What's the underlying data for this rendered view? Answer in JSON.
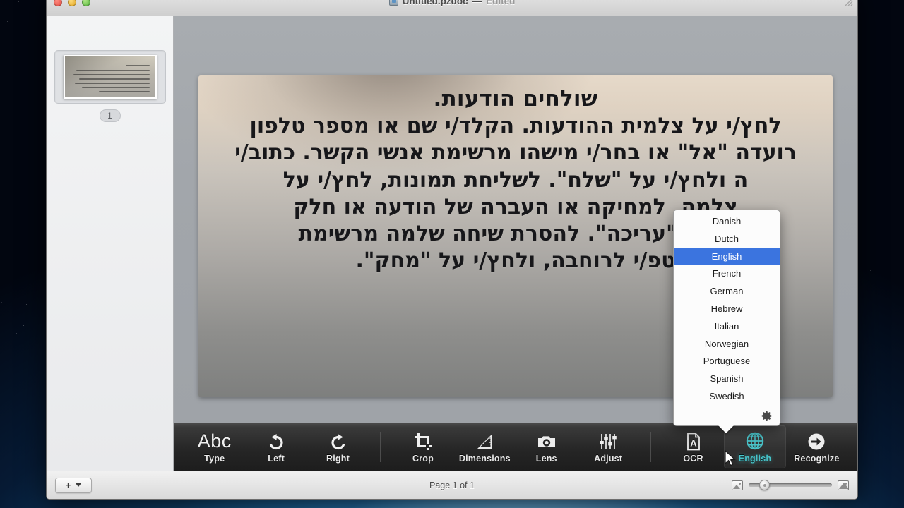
{
  "window": {
    "title": "Untitled.pzdoc",
    "separator": "—",
    "edited_label": "Edited",
    "doc_icon": "document-icon",
    "traffic": {
      "close": "close",
      "minimize": "minimize",
      "zoom": "zoom"
    }
  },
  "sidebar": {
    "page_badge": "1",
    "thumbnail_alt": "page-thumbnail"
  },
  "document": {
    "lines": [
      "שולחים הודעות.",
      "לחץ/י על צלמית ההודעות. הקלד/י שם או מספר טלפון",
      "רועדה \"אל\" או בחר/י מישהו מרשימת אנשי הקשר. כתוב/י",
      "ה ולחץ/י על \"שלח\". לשליחת תמונות, לחץ/י על",
      "צלמה. למחיקה או העברה של הודעה או חלק",
      "/י על \"עריכה\". להסרת שיחה שלמה מרשימת",
      "טפ/י לרוחבה, ולחץ/י על \"מחק\"."
    ]
  },
  "toolbar": {
    "items": [
      {
        "id": "type",
        "label": "Type",
        "icon": "abc-text-icon",
        "active": false
      },
      {
        "id": "left",
        "label": "Left",
        "icon": "rotate-left-icon",
        "active": false
      },
      {
        "id": "right",
        "label": "Right",
        "icon": "rotate-right-icon",
        "active": false
      },
      {
        "id": "crop",
        "label": "Crop",
        "icon": "crop-icon",
        "active": false
      },
      {
        "id": "dimensions",
        "label": "Dimensions",
        "icon": "ruler-triangle-icon",
        "active": false
      },
      {
        "id": "lens",
        "label": "Lens",
        "icon": "camera-icon",
        "active": false
      },
      {
        "id": "adjust",
        "label": "Adjust",
        "icon": "sliders-icon",
        "active": false
      },
      {
        "id": "ocr",
        "label": "OCR",
        "icon": "ocr-page-a-icon",
        "active": false
      },
      {
        "id": "language",
        "label": "English",
        "icon": "globe-icon",
        "active": true
      },
      {
        "id": "recognize",
        "label": "Recognize",
        "icon": "arrow-circle-right-icon",
        "active": false
      }
    ],
    "accent_color": "#49c3c9"
  },
  "language_menu": {
    "options": [
      "Danish",
      "Dutch",
      "English",
      "French",
      "German",
      "Hebrew",
      "Italian",
      "Norwegian",
      "Portuguese",
      "Spanish",
      "Swedish"
    ],
    "selected": "English",
    "selected_color": "#3b74df",
    "settings_icon": "gear-icon"
  },
  "statusbar": {
    "add_label": "+",
    "add_menu_icon": "chevron-down-icon",
    "page_status": "Page 1 of 1",
    "zoom_small_icon": "small-image-icon",
    "zoom_large_icon": "large-image-icon",
    "zoom_value": 15
  }
}
